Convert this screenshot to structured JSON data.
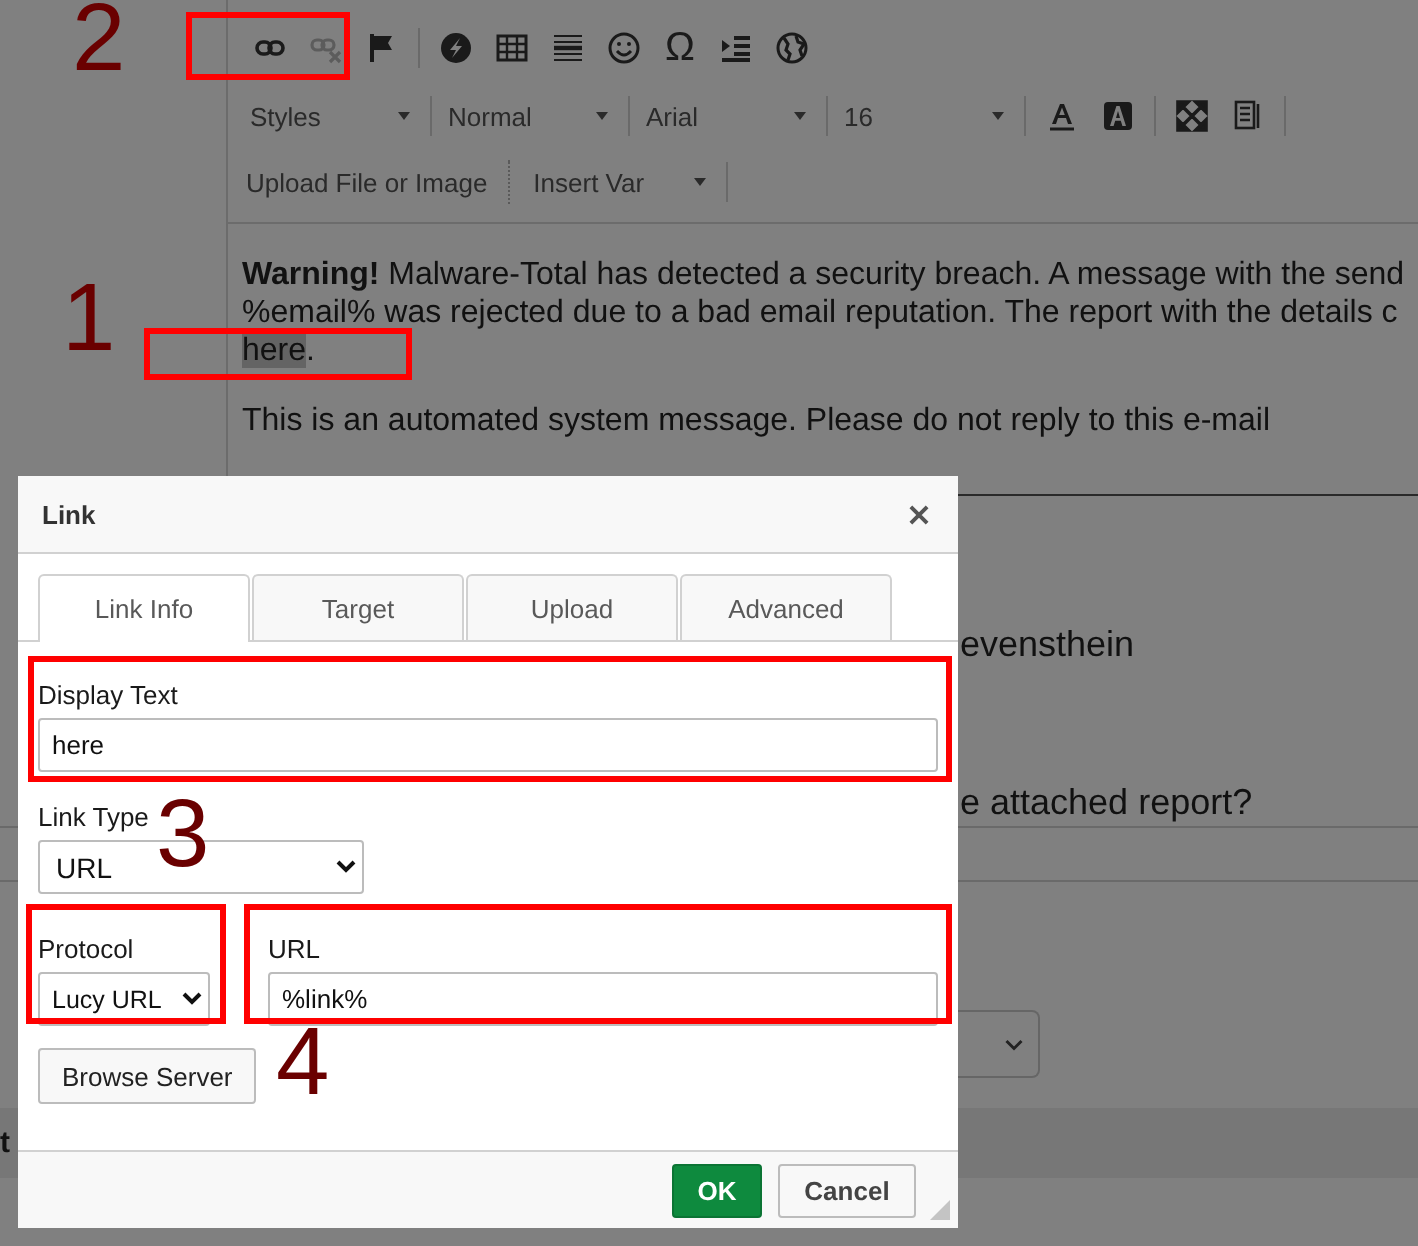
{
  "editor": {
    "toolbar": {
      "link_buttons": [
        {
          "disabled": false
        },
        {
          "disabled": true
        }
      ],
      "special_char": "Ω",
      "combos": [
        {
          "label": "Styles"
        },
        {
          "label": "Normal"
        },
        {
          "label": "Arial"
        },
        {
          "label": "16"
        }
      ],
      "upload_button": "Upload File or Image",
      "insert_var": "Insert Var"
    },
    "content": {
      "line_1": "**Warning!** Malware-Total has detected a security breach. A message with the send",
      "line_2": "%email% was rejected due to a bad email reputation. The report with the details c",
      "link": {
        "text": "here",
        "selected": true
      },
      "after_link": ".",
      "paragraph_2": "This is an automated system message. Please do not reply to this e-mail"
    }
  },
  "background": {
    "text_1": "evensthein",
    "text_2": "e attached report?",
    "section_label": "t"
  },
  "dialog": {
    "title": "Link",
    "tabs": [
      {
        "label": "Link Info",
        "selected": true
      },
      {
        "label": "Target",
        "selected": false
      },
      {
        "label": "Upload",
        "selected": false
      },
      {
        "label": "Advanced",
        "selected": false
      }
    ],
    "display_text": {
      "label": "Display Text",
      "value": "here"
    },
    "link_type": {
      "label": "Link Type",
      "value": "URL"
    },
    "protocol": {
      "label": "Protocol",
      "value": "Lucy URL"
    },
    "url": {
      "label": "URL",
      "value": "%link%"
    },
    "browse_button": "Browse Server",
    "ok_button": "OK",
    "cancel_button": "Cancel"
  },
  "annotations": [
    {
      "number": "2"
    },
    {
      "number": "1"
    },
    {
      "number": "3"
    },
    {
      "number": "4"
    }
  ]
}
